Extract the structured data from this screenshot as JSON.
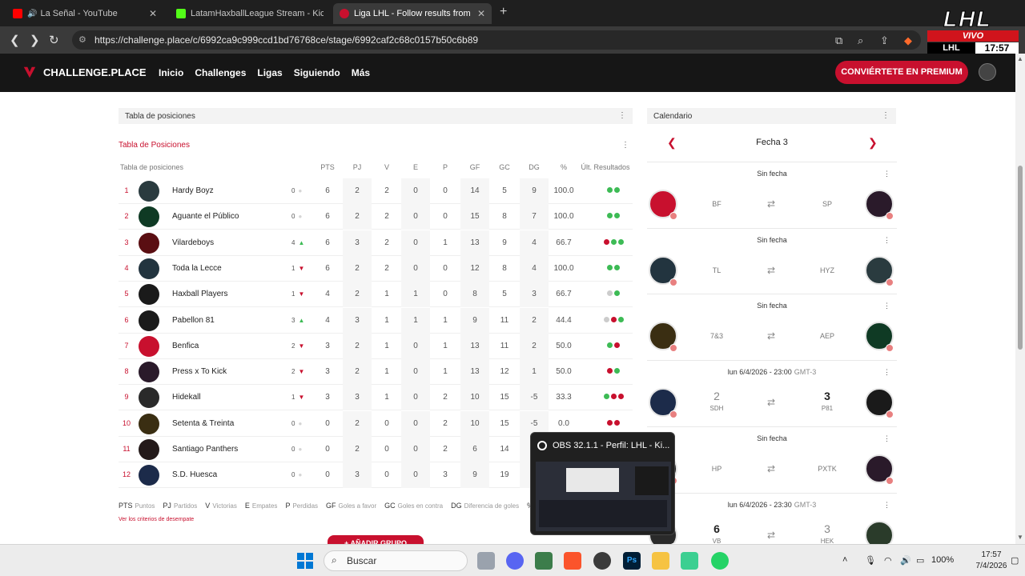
{
  "browser": {
    "tabs": [
      {
        "title": "La Señal - YouTube",
        "color": "#ff0000"
      },
      {
        "title": "LatamHaxballLeague Stream - Kick D",
        "color": "#53fc18"
      },
      {
        "title": "Liga LHL - Follow results from th",
        "color": "#c8102e"
      }
    ],
    "url": "https://challenge.place/c/6992ca9c999ccd1bd76768ce/stage/6992caf2c68c0157b50c6b89"
  },
  "overlay": {
    "logo": "LHL",
    "live": "VIVO",
    "league": "LHL",
    "time": "17:57"
  },
  "site": {
    "brand": "CHALLENGE.PLACE",
    "menu": [
      "Inicio",
      "Challenges",
      "Ligas",
      "Siguiendo",
      "Más"
    ],
    "premium": "CONVIÉRTETE EN PREMIUM"
  },
  "standings": {
    "card_title": "Tabla de posiciones",
    "link": "Tabla de Posiciones",
    "table_label": "Tabla de posiciones",
    "columns": [
      "PTS",
      "PJ",
      "V",
      "E",
      "P",
      "GF",
      "GC",
      "DG",
      "%",
      "Últ. Resultados"
    ],
    "rows": [
      {
        "pos": "1",
        "team": "Hardy Boyz",
        "chg": "0",
        "trend": "none",
        "pts": "6",
        "pj": "2",
        "v": "2",
        "e": "0",
        "p": "0",
        "gf": "14",
        "gc": "5",
        "dg": "9",
        "pct": "100.0",
        "res": [
          "W",
          "W"
        ]
      },
      {
        "pos": "2",
        "team": "Aguante el Público",
        "chg": "0",
        "trend": "none",
        "pts": "6",
        "pj": "2",
        "v": "2",
        "e": "0",
        "p": "0",
        "gf": "15",
        "gc": "8",
        "dg": "7",
        "pct": "100.0",
        "res": [
          "W",
          "W"
        ]
      },
      {
        "pos": "3",
        "team": "Vilardeboys",
        "chg": "4",
        "trend": "up",
        "pts": "6",
        "pj": "3",
        "v": "2",
        "e": "0",
        "p": "1",
        "gf": "13",
        "gc": "9",
        "dg": "4",
        "pct": "66.7",
        "res": [
          "L",
          "W",
          "W"
        ]
      },
      {
        "pos": "4",
        "team": "Toda la Lecce",
        "chg": "1",
        "trend": "down",
        "pts": "6",
        "pj": "2",
        "v": "2",
        "e": "0",
        "p": "0",
        "gf": "12",
        "gc": "8",
        "dg": "4",
        "pct": "100.0",
        "res": [
          "W",
          "W"
        ]
      },
      {
        "pos": "5",
        "team": "Haxball Players",
        "chg": "1",
        "trend": "down",
        "pts": "4",
        "pj": "2",
        "v": "1",
        "e": "1",
        "p": "0",
        "gf": "8",
        "gc": "5",
        "dg": "3",
        "pct": "66.7",
        "res": [
          "D",
          "W"
        ]
      },
      {
        "pos": "6",
        "team": "Pabellon 81",
        "chg": "3",
        "trend": "up",
        "pts": "4",
        "pj": "3",
        "v": "1",
        "e": "1",
        "p": "1",
        "gf": "9",
        "gc": "11",
        "dg": "2",
        "pct": "44.4",
        "res": [
          "D",
          "L",
          "W"
        ]
      },
      {
        "pos": "7",
        "team": "Benfica",
        "chg": "2",
        "trend": "down",
        "pts": "3",
        "pj": "2",
        "v": "1",
        "e": "0",
        "p": "1",
        "gf": "13",
        "gc": "11",
        "dg": "2",
        "pct": "50.0",
        "res": [
          "W",
          "L"
        ]
      },
      {
        "pos": "8",
        "team": "Press x To Kick",
        "chg": "2",
        "trend": "down",
        "pts": "3",
        "pj": "2",
        "v": "1",
        "e": "0",
        "p": "1",
        "gf": "13",
        "gc": "12",
        "dg": "1",
        "pct": "50.0",
        "res": [
          "L",
          "W"
        ]
      },
      {
        "pos": "9",
        "team": "Hidekall",
        "chg": "1",
        "trend": "down",
        "pts": "3",
        "pj": "3",
        "v": "1",
        "e": "0",
        "p": "2",
        "gf": "10",
        "gc": "15",
        "dg": "-5",
        "pct": "33.3",
        "res": [
          "W",
          "L",
          "L"
        ]
      },
      {
        "pos": "10",
        "team": "Setenta & Treinta",
        "chg": "0",
        "trend": "none",
        "pts": "0",
        "pj": "2",
        "v": "0",
        "e": "0",
        "p": "2",
        "gf": "10",
        "gc": "15",
        "dg": "-5",
        "pct": "0.0",
        "res": [
          "L",
          "L"
        ]
      },
      {
        "pos": "11",
        "team": "Santiago Panthers",
        "chg": "0",
        "trend": "none",
        "pts": "0",
        "pj": "2",
        "v": "0",
        "e": "0",
        "p": "2",
        "gf": "6",
        "gc": "14",
        "dg": "",
        "pct": "",
        "res": []
      },
      {
        "pos": "12",
        "team": "S.D. Huesca",
        "chg": "0",
        "trend": "none",
        "pts": "0",
        "pj": "3",
        "v": "0",
        "e": "0",
        "p": "3",
        "gf": "9",
        "gc": "19",
        "dg": "",
        "pct": "",
        "res": []
      }
    ],
    "legend": [
      {
        "k": "PTS",
        "v": "Puntos"
      },
      {
        "k": "PJ",
        "v": "Partidos"
      },
      {
        "k": "V",
        "v": "Victorias"
      },
      {
        "k": "E",
        "v": "Empates"
      },
      {
        "k": "P",
        "v": "Perdidas"
      },
      {
        "k": "GF",
        "v": "Goles a favor"
      },
      {
        "k": "GC",
        "v": "Goles en contra"
      },
      {
        "k": "DG",
        "v": "Diferencia de goles"
      },
      {
        "k": "%",
        "v": ""
      }
    ],
    "criteria": "Ver los criterios de desempate",
    "add_group": "+ AÑADIR GRUPO"
  },
  "calendar": {
    "card_title": "Calendario",
    "round": "Fecha 3",
    "matches": [
      {
        "date": "Sin fecha",
        "tz": "",
        "home": "BF",
        "away": "SP",
        "hs": "",
        "as": ""
      },
      {
        "date": "Sin fecha",
        "tz": "",
        "home": "TL",
        "away": "HYZ",
        "hs": "",
        "as": ""
      },
      {
        "date": "Sin fecha",
        "tz": "",
        "home": "7&3",
        "away": "AEP",
        "hs": "",
        "as": ""
      },
      {
        "date": "lun 6/4/2026 - 23:00",
        "tz": "GMT-3",
        "home": "SDH",
        "away": "P81",
        "hs": "2",
        "as": "3"
      },
      {
        "date": "Sin fecha",
        "tz": "",
        "home": "HP",
        "away": "PXTK",
        "hs": "",
        "as": ""
      },
      {
        "date": "lun 6/4/2026 - 23:30",
        "tz": "GMT-3",
        "home": "VB",
        "away": "HEK",
        "hs": "6",
        "as": "3"
      }
    ]
  },
  "obs": {
    "title": "OBS 32.1.1 - Perfil: LHL - Ki..."
  },
  "taskbar": {
    "search": "Buscar",
    "battery": "100%",
    "time": "17:57",
    "date": "7/4/2026"
  },
  "colors": {
    "accent": "#c8102e",
    "win": "#3dbb55",
    "loss": "#c8102e",
    "draw": "#cccccc"
  }
}
